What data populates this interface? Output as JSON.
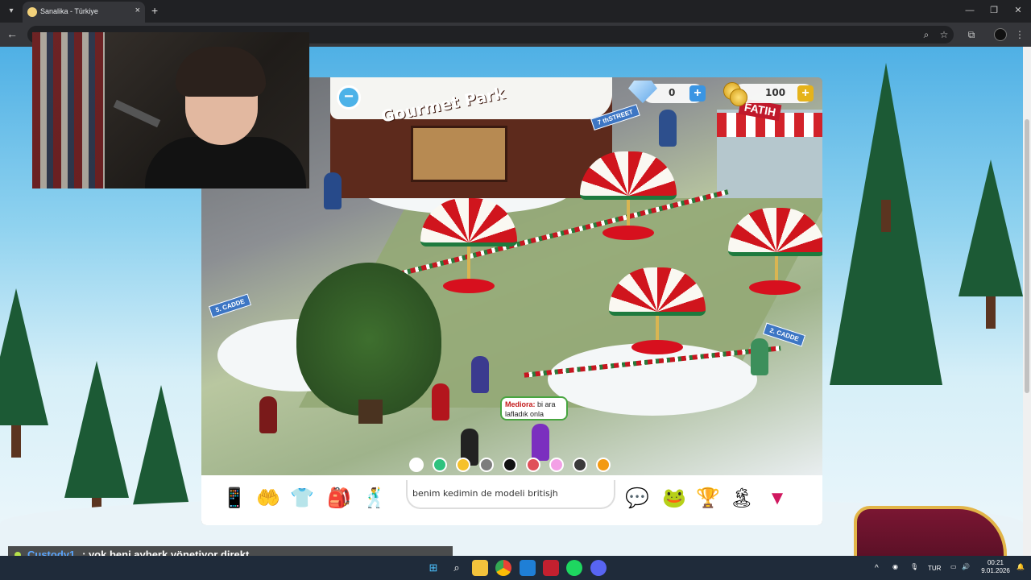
{
  "browser": {
    "tab_title": "Sanalika - Türkiye",
    "tab_list_icon": "chevron-down-icon",
    "new_tab": "+",
    "close_tab": "×",
    "window_controls": [
      "—",
      "❐",
      "✕"
    ],
    "toolbar_icons": [
      "zoom-icon",
      "star-icon",
      "extensions-icon",
      "menu-icon"
    ]
  },
  "game": {
    "shop_sign": "Gourmet Park",
    "stand_sign": "FATIH",
    "street_signs": [
      "7 thSTREET",
      "5. CADDE",
      "2. CADDE"
    ],
    "gems": "0",
    "coins": "100",
    "plus": "+",
    "minus": "−",
    "speech_bubble": {
      "author": "Mediora:",
      "text": " bi ara lafladık onla"
    },
    "palette": [
      "#ffffff",
      "#2ec27e",
      "#f6c12b",
      "#7d7d7d",
      "#111111",
      "#e0505a",
      "#f3a0e6",
      "#3a3a3a",
      "#f39a12"
    ],
    "hud_left_icons": [
      "phone-icon",
      "hands-icon",
      "outfit-icon",
      "backpack-icon",
      "dance-icon"
    ],
    "chat_input_value": "benim kedimin de modeli britisjh",
    "hud_right_icons": [
      "chat-bubbles-icon",
      "pet-icon",
      "trophy-icon",
      "island-icon",
      "heart-triangle-icon"
    ]
  },
  "stream_chat": {
    "user": "Custody1",
    "message": ": yok beni ayberk yönetiyor direkt"
  },
  "taskbar": {
    "apps": [
      "windows-icon",
      "search-icon",
      "file-explorer-icon",
      "chrome-icon",
      "photos-icon",
      "voicemeeter-icon",
      "spotify-icon",
      "discord-icon"
    ],
    "language": "TUR",
    "time": "00:21",
    "date": "9.01.2026"
  }
}
